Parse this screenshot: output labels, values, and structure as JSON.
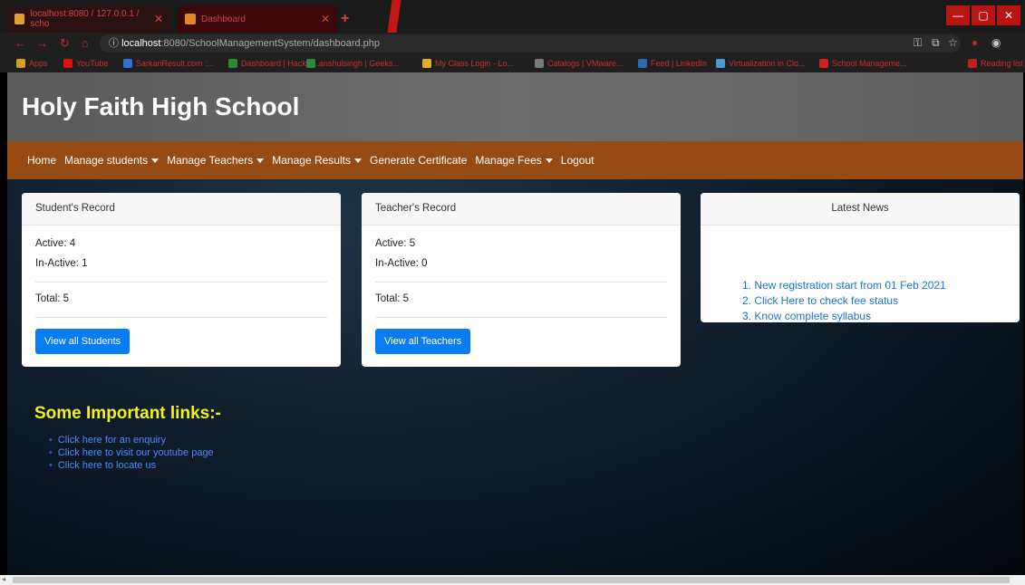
{
  "browser": {
    "tab1_title": "localhost:8080 / 127.0.0.1 / scho",
    "tab2_title": "Dashboard",
    "url_host": "localhost",
    "url_path": ":8080/SchoolManagementSystem/dashboard.php",
    "bookmarks": [
      "Apps",
      "YouTube",
      "SarkariResult.com :...",
      "Dashboard | Hacker...",
      "anshulsingh | Geeks...",
      "My Class Login - Lo...",
      "Catalogs | VMware...",
      "Feed | LinkedIn",
      "Virtualization in Clo...",
      "School Manageme...",
      "Reading list"
    ],
    "accent": "#c31515"
  },
  "site": {
    "title": "Holy Faith High School"
  },
  "nav": {
    "items": [
      {
        "label": "Home"
      },
      {
        "label": "Manage students"
      },
      {
        "label": "Manage Teachers"
      },
      {
        "label": "Manage Results"
      },
      {
        "label": "Generate Certificate"
      },
      {
        "label": "Manage Fees"
      },
      {
        "label": "Logout"
      }
    ],
    "color": "#964a14"
  },
  "students": {
    "header": "Student's Record",
    "active": "Active: 4",
    "inactive": "In-Active: 1",
    "total": "Total: 5",
    "button": "View all Students"
  },
  "teachers": {
    "header": "Teacher's Record",
    "active": "Active: 5",
    "inactive": "In-Active: 0",
    "total": "Total: 5",
    "button": "View all Teachers"
  },
  "news": {
    "header": "Latest News",
    "items": [
      "1. New registration start from 01 Feb 2021",
      "2. Click Here to check fee status",
      "3. Know complete syllabus"
    ]
  },
  "links": {
    "title": "Some Important links:-",
    "items": [
      "Click here for an enquiry",
      "Click here to visit our youtube page",
      "Click here to locate us"
    ]
  }
}
